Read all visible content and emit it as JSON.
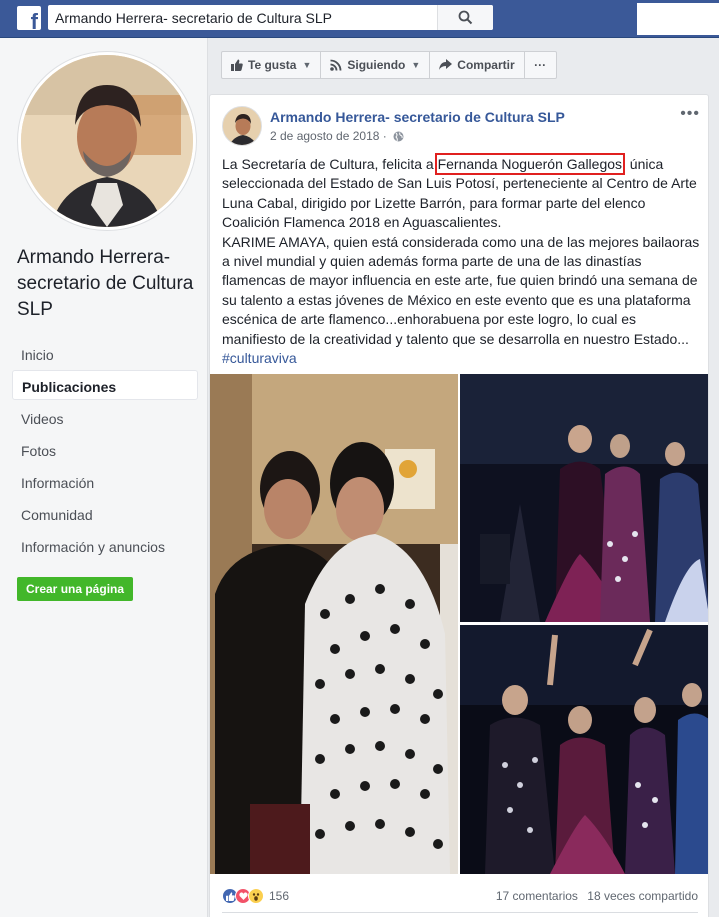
{
  "topbar": {
    "logo": "f",
    "search_value": "Armando Herrera- secretario de Cultura SLP",
    "icons": [
      "facebook-logo-icon",
      "search-icon"
    ]
  },
  "sidebar": {
    "page_name": "Armando Herrera- secretario de Cultura SLP",
    "items": [
      {
        "label": "Inicio",
        "active": false
      },
      {
        "label": "Publicaciones",
        "active": true
      },
      {
        "label": "Videos",
        "active": false
      },
      {
        "label": "Fotos",
        "active": false
      },
      {
        "label": "Información",
        "active": false
      },
      {
        "label": "Comunidad",
        "active": false
      },
      {
        "label": "Información y anuncios",
        "active": false
      }
    ],
    "create_page_label": "Crear una página"
  },
  "actions": {
    "like_label": "Te gusta",
    "follow_label": "Siguiendo",
    "share_label": "Compartir",
    "more_label": "···"
  },
  "post": {
    "author": "Armando Herrera- secretario de Cultura SLP",
    "date": "2 de agosto de 2018 ·",
    "options_label": "•••",
    "text_before": "La Secretaría de Cultura, felicita a ",
    "highlighted_name": "Fernanda Noguerón Gallegos",
    "text_after": ", única seleccionada del Estado de San Luis Potosí, perteneciente al Centro de Arte Luna Cabal, dirigido por Lizette Barrón, para formar parte del elenco Coalición Flamenca 2018 en Aguascalientes.",
    "paragraph2": "KARIME AMAYA, quien está considerada como una de las mejores bailaoras a nivel mundial y quien además forma parte de una de las dinastías flamencas de mayor influencia en este arte, fue quien brindó una semana de su talento a estas jóvenes de México en este evento que es una plataforma escénica de arte flamenco...enhorabuena por este logro, lo cual es manifiesto de la creatividad y talento que se desarrolla en nuestro Estado... ",
    "hashtag": "#culturaviva",
    "reaction_count": "156",
    "comments": "17 comentarios",
    "shares": "18 veces compartido"
  },
  "colors": {
    "brand": "#3b5998",
    "link": "#365899",
    "highlight_box": "#e0201f",
    "create_button": "#42b72a"
  }
}
